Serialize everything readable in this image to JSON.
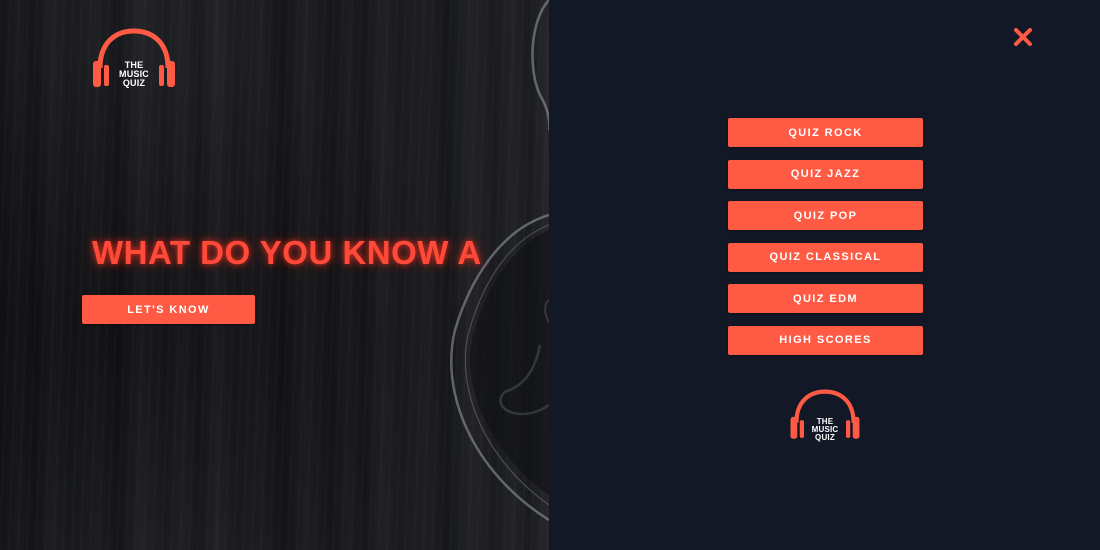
{
  "logo": {
    "line1": "THE",
    "line2": "MUSIC",
    "line3": "QUIZ",
    "icon": "headphones-icon"
  },
  "hero": {
    "title": "WHAT DO YOU KNOW A",
    "cta_label": "LET'S KNOW"
  },
  "menu": {
    "close_icon": "close-icon",
    "items": [
      {
        "label": "QUIZ ROCK"
      },
      {
        "label": "QUIZ JAZZ"
      },
      {
        "label": "QUIZ POP"
      },
      {
        "label": "QUIZ CLASSICAL"
      },
      {
        "label": "QUIZ EDM"
      },
      {
        "label": "HIGH SCORES"
      }
    ]
  },
  "colors": {
    "accent": "#ff5a44",
    "title": "#ff4a3a",
    "panel_bg": "#121826",
    "text_on_accent": "#ffffff"
  }
}
